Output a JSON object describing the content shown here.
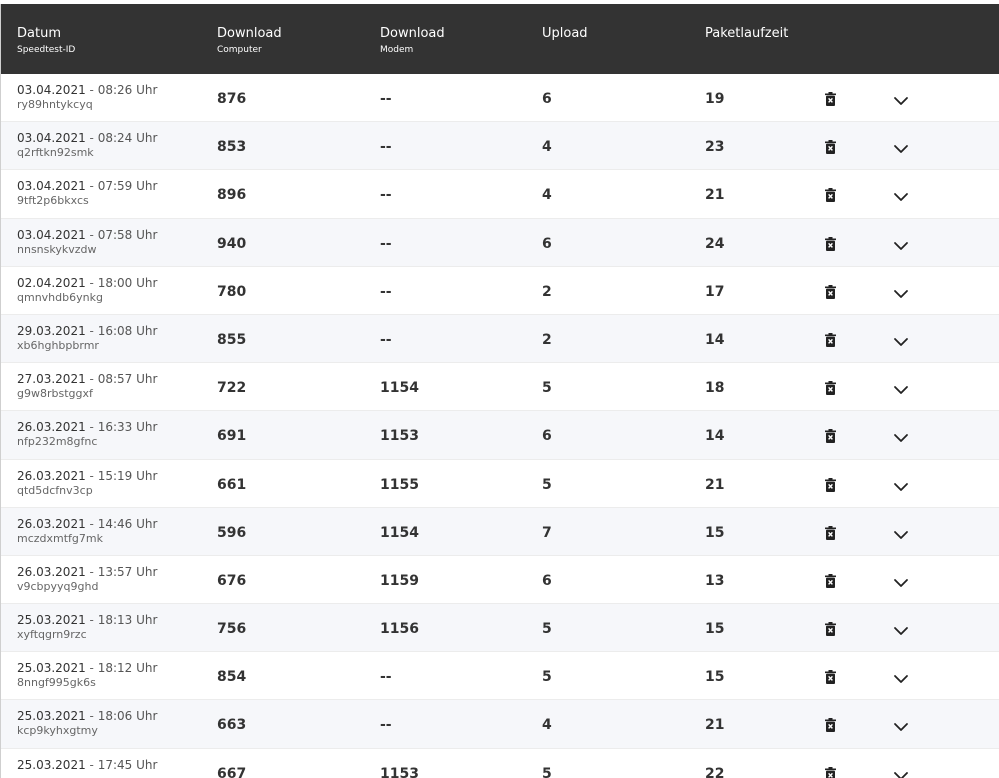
{
  "table": {
    "headers": {
      "date": {
        "main": "Datum",
        "sub": "Speedtest-ID"
      },
      "download_computer": {
        "main": "Download",
        "sub": "Computer"
      },
      "download_modem": {
        "main": "Download",
        "sub": "Modem"
      },
      "upload": {
        "main": "Upload"
      },
      "ping": {
        "main": "Paketlaufzeit"
      }
    },
    "row_icons": {
      "delete": "trash-icon",
      "expand": "chevron-down-icon"
    },
    "rows": [
      {
        "date": "03.04.2021",
        "time": "08:26 Uhr",
        "id": "ry89hntykcyq",
        "download_computer": "876",
        "download_modem": "--",
        "upload": "6",
        "ping": "19"
      },
      {
        "date": "03.04.2021",
        "time": "08:24 Uhr",
        "id": "q2rftkn92smk",
        "download_computer": "853",
        "download_modem": "--",
        "upload": "4",
        "ping": "23"
      },
      {
        "date": "03.04.2021",
        "time": "07:59 Uhr",
        "id": "9tft2p6bkxcs",
        "download_computer": "896",
        "download_modem": "--",
        "upload": "4",
        "ping": "21"
      },
      {
        "date": "03.04.2021",
        "time": "07:58 Uhr",
        "id": "nnsnskykvzdw",
        "download_computer": "940",
        "download_modem": "--",
        "upload": "6",
        "ping": "24"
      },
      {
        "date": "02.04.2021",
        "time": "18:00 Uhr",
        "id": "qmnvhdb6ynkg",
        "download_computer": "780",
        "download_modem": "--",
        "upload": "2",
        "ping": "17"
      },
      {
        "date": "29.03.2021",
        "time": "16:08 Uhr",
        "id": "xb6hghbpbrmr",
        "download_computer": "855",
        "download_modem": "--",
        "upload": "2",
        "ping": "14"
      },
      {
        "date": "27.03.2021",
        "time": "08:57 Uhr",
        "id": "g9w8rbstggxf",
        "download_computer": "722",
        "download_modem": "1154",
        "upload": "5",
        "ping": "18"
      },
      {
        "date": "26.03.2021",
        "time": "16:33 Uhr",
        "id": "nfp232m8gfnc",
        "download_computer": "691",
        "download_modem": "1153",
        "upload": "6",
        "ping": "14"
      },
      {
        "date": "26.03.2021",
        "time": "15:19 Uhr",
        "id": "qtd5dcfnv3cp",
        "download_computer": "661",
        "download_modem": "1155",
        "upload": "5",
        "ping": "21"
      },
      {
        "date": "26.03.2021",
        "time": "14:46 Uhr",
        "id": "mczdxmtfg7mk",
        "download_computer": "596",
        "download_modem": "1154",
        "upload": "7",
        "ping": "15"
      },
      {
        "date": "26.03.2021",
        "time": "13:57 Uhr",
        "id": "v9cbpyyq9ghd",
        "download_computer": "676",
        "download_modem": "1159",
        "upload": "6",
        "ping": "13"
      },
      {
        "date": "25.03.2021",
        "time": "18:13 Uhr",
        "id": "xyftqgrn9rzc",
        "download_computer": "756",
        "download_modem": "1156",
        "upload": "5",
        "ping": "15"
      },
      {
        "date": "25.03.2021",
        "time": "18:12 Uhr",
        "id": "8nngf995gk6s",
        "download_computer": "854",
        "download_modem": "--",
        "upload": "5",
        "ping": "15"
      },
      {
        "date": "25.03.2021",
        "time": "18:06 Uhr",
        "id": "kcp9kyhxgtmy",
        "download_computer": "663",
        "download_modem": "--",
        "upload": "4",
        "ping": "21"
      },
      {
        "date": "25.03.2021",
        "time": "17:45 Uhr",
        "id": "",
        "download_computer": "667",
        "download_modem": "1153",
        "upload": "5",
        "ping": "22"
      }
    ]
  }
}
